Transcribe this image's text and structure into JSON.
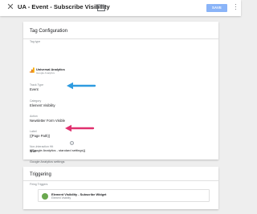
{
  "header": {
    "title": "UA - Event - Subscribe Visibility",
    "save_label": "SAVE"
  },
  "tag_configuration": {
    "title": "Tag Configuration",
    "tag_type_label": "Tag type",
    "tag_type_name": "Universal Analytics",
    "tag_type_vendor": "Google Analytics",
    "track_type_label": "Track Type",
    "track_type_value": "Event",
    "category_label": "Category",
    "category_value": "Element Visibility",
    "action_label": "Action",
    "action_value": "Newsletter Form Visible",
    "label_label": "Label",
    "label_value": "{{Page Path}}",
    "non_interaction_label": "Non-Interaction Hit",
    "non_interaction_value": "True",
    "ga_settings_label": "Google Analytics settings",
    "ga_settings_value": "{{Google Analytics - standard settings}}"
  },
  "triggering": {
    "title": "Triggering",
    "firing_label": "Firing Triggers",
    "triggers": [
      {
        "name": "Element Visibility - Subscribe Widget",
        "type": "Element Visibility"
      }
    ]
  },
  "colors": {
    "save_button": "#8ab4f8",
    "annotation_arrow_blue": "#2e9be0",
    "annotation_arrow_pink": "#e0306f",
    "trigger_icon": "#6aa84f",
    "ga_icon": "#f9ab00"
  },
  "icons": {
    "close": "close-icon",
    "folder": "folder-icon",
    "menu": "more-vert-icon",
    "tag_type": "google-analytics-icon",
    "trigger": "element-visibility-icon",
    "help": "help-icon"
  }
}
